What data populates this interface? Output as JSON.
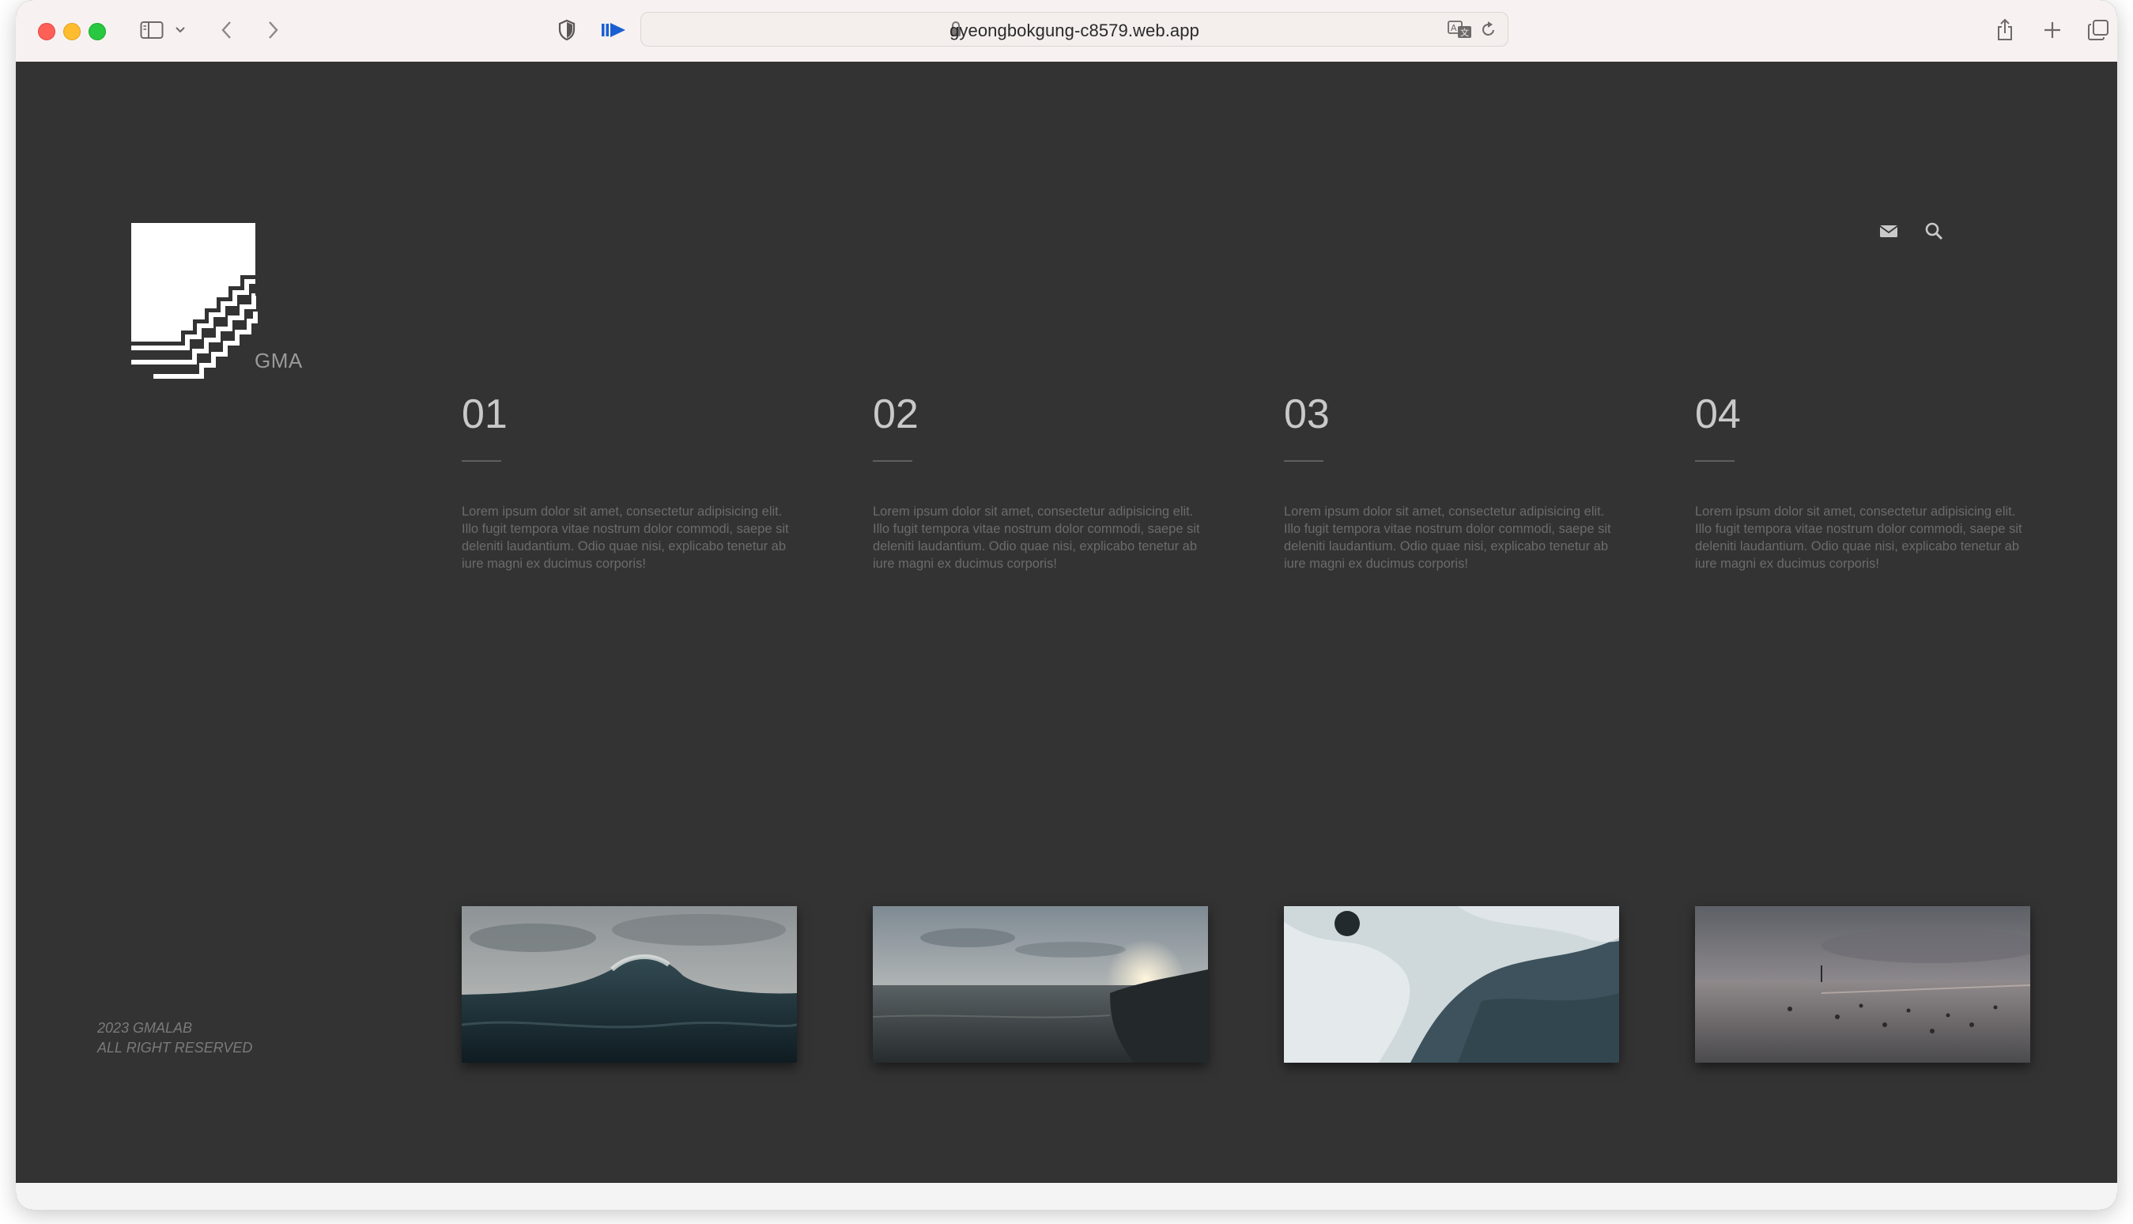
{
  "browser": {
    "url": "gyeongbokgung-c8579.web.app",
    "icons": [
      "sidebar-icon",
      "chevron-down-icon",
      "back-icon",
      "forward-icon",
      "shield-icon",
      "reader-icon",
      "lock-icon",
      "translate-icon",
      "reload-icon",
      "share-icon",
      "new-tab-icon",
      "tabs-icon"
    ]
  },
  "site": {
    "logo_text": "GMA",
    "header_icons": [
      "mail-icon",
      "search-icon"
    ],
    "columns": [
      {
        "number": "01",
        "text": "Lorem ipsum dolor sit amet, consectetur adipisicing elit. Illo fugit tempora vitae nostrum dolor commodi, saepe sit deleniti laudantium. Odio quae nisi, explicabo tenetur ab iure magni ex ducimus corporis!"
      },
      {
        "number": "02",
        "text": "Lorem ipsum dolor sit amet, consectetur adipisicing elit. Illo fugit tempora vitae nostrum dolor commodi, saepe sit deleniti laudantium. Odio quae nisi, explicabo tenetur ab iure magni ex ducimus corporis!"
      },
      {
        "number": "03",
        "text": "Lorem ipsum dolor sit amet, consectetur adipisicing elit. Illo fugit tempora vitae nostrum dolor commodi, saepe sit deleniti laudantium. Odio quae nisi, explicabo tenetur ab iure magni ex ducimus corporis!"
      },
      {
        "number": "04",
        "text": "Lorem ipsum dolor sit amet, consectetur adipisicing elit. Illo fugit tempora vitae nostrum dolor commodi, saepe sit deleniti laudantium. Odio quae nisi, explicabo tenetur ab iure magni ex ducimus corporis!"
      }
    ],
    "footer": {
      "line1": "2023 GMALAB",
      "line2": "ALL RIGHT RESERVED"
    }
  },
  "colors": {
    "page_bg": "#333333",
    "titlebar_bg": "#f7f2f1",
    "accent_blue": "#1a5fd1"
  }
}
